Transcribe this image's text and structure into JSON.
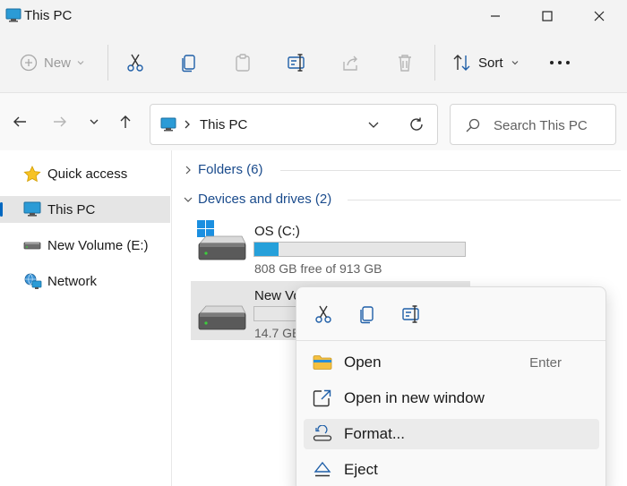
{
  "window": {
    "title": "This PC"
  },
  "toolbar": {
    "new_label": "New",
    "sort_label": "Sort"
  },
  "address": {
    "path": "This PC",
    "search_placeholder": "Search This PC"
  },
  "sidebar": {
    "items": [
      {
        "label": "Quick access",
        "icon": "star-icon"
      },
      {
        "label": "This PC",
        "icon": "monitor-icon",
        "selected": true
      },
      {
        "label": "New Volume (E:)",
        "icon": "drive-icon"
      },
      {
        "label": "Network",
        "icon": "network-icon"
      }
    ]
  },
  "groups": {
    "folders": "Folders (6)",
    "devices": "Devices and drives (2)"
  },
  "drives": [
    {
      "name": "OS (C:)",
      "free_text": "808 GB free of 913 GB",
      "used_fraction": 0.115
    },
    {
      "name": "New Vo",
      "free_text": "14.7 GB",
      "used_fraction": 0.0
    }
  ],
  "context_menu": {
    "items": [
      {
        "label": "Open",
        "shortcut": "Enter",
        "icon": "folder-icon"
      },
      {
        "label": "Open in new window",
        "icon": "open-window-icon"
      },
      {
        "label": "Format...",
        "icon": "format-icon"
      },
      {
        "label": "Eject",
        "icon": "eject-icon"
      }
    ]
  },
  "colors": {
    "accent": "#0067c0",
    "usage_bar": "#26a0da",
    "group_header": "#1a4b8c"
  }
}
